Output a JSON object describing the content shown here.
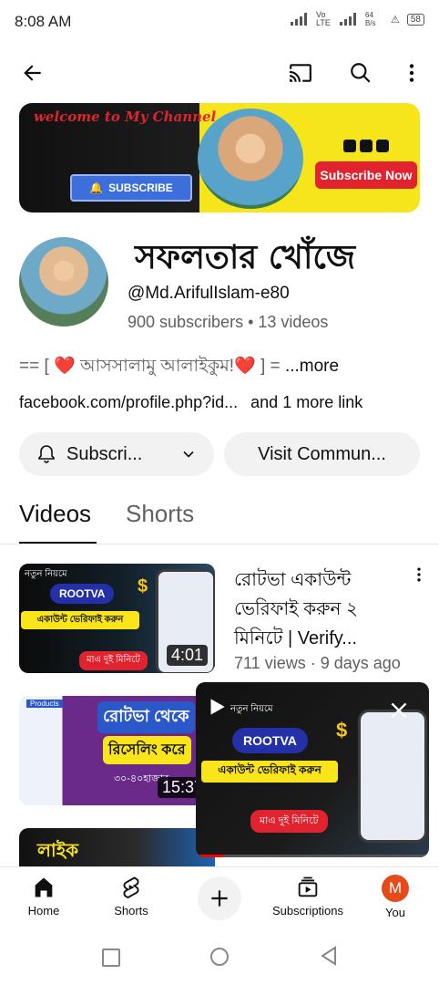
{
  "status_bar": {
    "time": "8:08 AM",
    "net": "Vo LTE",
    "speed": "64 B/s",
    "battery": "58"
  },
  "appbar": {
    "back_icon": "arrow-left-icon",
    "cast_icon": "cast-icon",
    "search_icon": "search-icon",
    "menu_icon": "more-vert-icon"
  },
  "banner": {
    "title": "welcome to My Channel",
    "subscribe": "SUBSCRIBE",
    "subscribe_now": "Subscribe Now"
  },
  "channel": {
    "name": "সফলতার খোঁজে",
    "handle": "@Md.Ariful​Islam-e80",
    "counts": "900 subscribers • 13 videos",
    "description": "== [ ❤️ আসসালামু আলাইকুম!❤️ ] = ",
    "description_more": "...more",
    "link": "facebook.com/profile.php?id...",
    "link_more": "and 1 more link"
  },
  "buttons": {
    "subscribe": "Subscri...",
    "visit_community": "Visit Commun..."
  },
  "tabs": [
    {
      "label": "Videos",
      "active": true
    },
    {
      "label": "Shorts",
      "active": false
    }
  ],
  "videos": [
    {
      "title": "রোটভা একাউন্ট ভেরিফাই করুন ২ মিনিটে | Verify...",
      "meta": "711 views · 9 days ago",
      "duration": "4:01",
      "thumb_text": {
        "top": "নতুন নিয়মে",
        "badge": "ROOTVA",
        "bar": "একাউন্ট ভেরিফাই করুন",
        "bottom": "মাএ দুই মিনিটে"
      }
    },
    {
      "title": "",
      "meta": "",
      "duration": "15:37",
      "thumb_text": {
        "top": "Products",
        "line1": "রোটভা থেকে",
        "line2": "রিসেলিং করে",
        "line3": "৩০-৪০হাজার"
      }
    },
    {
      "title": "",
      "meta": "",
      "duration": "",
      "thumb_text": {
        "top": "লাইক"
      }
    }
  ],
  "mini_player": {
    "overline": "নতুন নিয়মে",
    "badge": "ROOTVA",
    "bar": "একাউন্ট ভেরিফাই করুন",
    "bottom": "মাএ দুই মিনিটে",
    "play_icon": "play-icon",
    "close_icon": "close-icon"
  },
  "bottom_nav": [
    {
      "label": "Home",
      "icon": "home-icon"
    },
    {
      "label": "Shorts",
      "icon": "shorts-icon"
    },
    {
      "label": "",
      "icon": "plus-icon"
    },
    {
      "label": "Subscriptions",
      "icon": "subscriptions-icon"
    },
    {
      "label": "You",
      "icon": "avatar",
      "avatar_letter": "M"
    }
  ],
  "colors": {
    "accent_red": "#ff0000",
    "text_primary": "#0f0f0f",
    "text_secondary": "#606060",
    "chip_bg": "#f2f2f2",
    "avatar_you": "#e64a19"
  }
}
